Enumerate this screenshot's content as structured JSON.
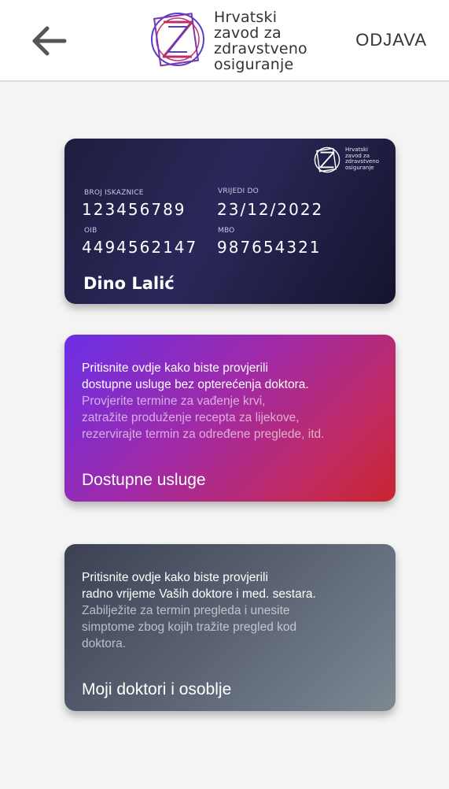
{
  "header": {
    "back_icon": "arrow-left-icon",
    "logo_lines": [
      "Hrvatski",
      "zavod za",
      "zdravstveno",
      "osiguranje"
    ],
    "logout_label": "ODJAVA"
  },
  "id_card": {
    "card_number_label": "BROJ ISKAZNICE",
    "card_number": "123456789",
    "valid_until_label": "VRIJEDI DO",
    "valid_until": "23/12/2022",
    "oib_label": "OIB",
    "oib": "4494562147",
    "mbo_label": "MBO",
    "mbo": "987654321",
    "holder_name": "Dino Lalić",
    "logo_lines": [
      "Hrvatski",
      "zavod za",
      "zdravstveno",
      "osiguranje"
    ]
  },
  "services_card": {
    "lines_strong": [
      "Pritisnite ovdje kako biste provjerili",
      "dostupne usluge bez opterećenja doktora."
    ],
    "lines_muted": [
      "Provjerite termine za vađenje krvi,",
      "zatražite produženje recepta za lijekove,",
      "rezervirajte termin za određene preglede, itd."
    ],
    "title": "Dostupne usluge"
  },
  "staff_card": {
    "lines_strong": [
      "Pritisnite ovdje kako biste provjerili",
      "radno vrijeme Vaših doktore i med. sestara."
    ],
    "lines_muted": [
      "Zabilježite za termin pregleda i unesite",
      "simptome zbog kojih tražite pregled kod",
      "doktora."
    ],
    "title": "Moji doktori i osoblje"
  }
}
